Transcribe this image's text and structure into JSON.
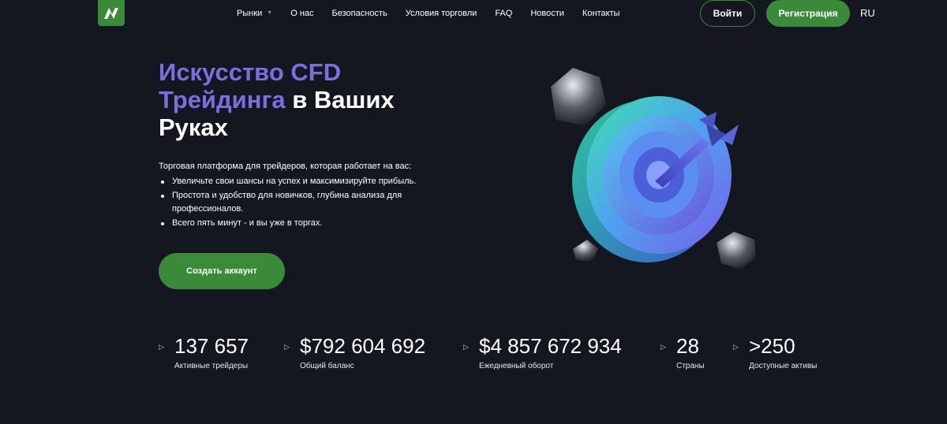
{
  "header": {
    "nav": [
      {
        "label": "Рынки",
        "has_dropdown": true
      },
      {
        "label": "О нас"
      },
      {
        "label": "Безопасность"
      },
      {
        "label": "Условия торговли"
      },
      {
        "label": "FAQ"
      },
      {
        "label": "Новости"
      },
      {
        "label": "Контакты"
      }
    ],
    "login_label": "Войти",
    "register_label": "Регистрация",
    "language": "RU"
  },
  "hero": {
    "title_accent_1": "Искусство CFD",
    "title_accent_2": "Трейдинга",
    "title_rest_1": " в Ваших",
    "title_rest_2": "Руках",
    "description": "Торговая платформа для трейдеров, которая работает на вас:",
    "bullets": [
      "Увеличьте свои шансы на успех и максимизируйте прибыль.",
      "Простота и удобство для новичков, глубина анализа для профессионалов.",
      "Всего пять минут - и вы уже в торгах."
    ],
    "cta_label": "Создать аккаунт"
  },
  "stats": [
    {
      "value": "137 657",
      "label": "Активные трейдеры"
    },
    {
      "value": "$792 604 692",
      "label": "Общий баланс"
    },
    {
      "value": "$4 857 672 934",
      "label": "Ежедневный оборот"
    },
    {
      "value": "28",
      "label": "Страны"
    },
    {
      "value": ">250",
      "label": "Доступные активы"
    }
  ],
  "colors": {
    "background": "#14171f",
    "brand_green": "#3a8a3a",
    "accent_purple": "#7b6fe0"
  },
  "icons": {
    "logo": "brand-logo-icon",
    "stat_marker": "triangle-right-icon",
    "dropdown": "chevron-down-icon"
  }
}
